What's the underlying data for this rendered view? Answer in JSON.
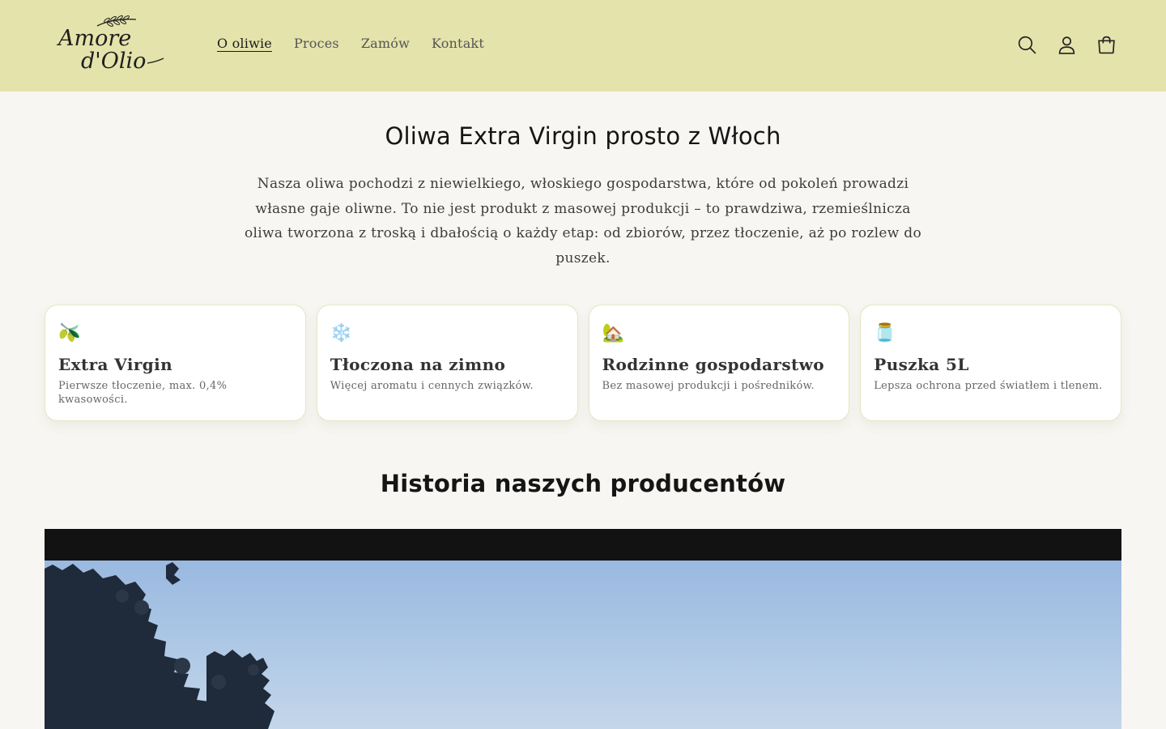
{
  "brand": {
    "logo_text": "Amore d'Olio"
  },
  "nav": {
    "items": [
      {
        "label": "O oliwie",
        "active": true
      },
      {
        "label": "Proces",
        "active": false
      },
      {
        "label": "Zamów",
        "active": false
      },
      {
        "label": "Kontakt",
        "active": false
      }
    ]
  },
  "header_icons": [
    "search-icon",
    "account-icon",
    "cart-icon"
  ],
  "hero": {
    "title": "Oliwa Extra Virgin prosto z Włoch",
    "description": "Nasza oliwa pochodzi z niewielkiego, włoskiego gospodarstwa, które od pokoleń prowadzi własne gaje oliwne. To nie jest produkt z masowej produkcji – to prawdziwa, rzemieślnicza oliwa tworzona z troską i dbałością o każdy etap: od zbiorów, przez tłoczenie, aż po rozlew do puszek."
  },
  "features": [
    {
      "icon": "🫒",
      "icon_name": "olive-icon",
      "title": "Extra Virgin",
      "desc": "Pierwsze tłoczenie, max. 0,4% kwasowości."
    },
    {
      "icon": "❄️",
      "icon_name": "snowflake-icon",
      "title": "Tłoczona na zimno",
      "desc": "Więcej aromatu i cennych związków."
    },
    {
      "icon": "🏡",
      "icon_name": "house-icon",
      "title": "Rodzinne gospodarstwo",
      "desc": "Bez masowej produkcji i pośredników."
    },
    {
      "icon": "🫙",
      "icon_name": "jar-icon",
      "title": "Puszka 5L",
      "desc": "Lepsza ochrona przed światłem i tlenem."
    }
  ],
  "producers": {
    "title": "Historia naszych producentów"
  },
  "colors": {
    "header_bg": "#e4e3ab",
    "page_bg": "#f8f6f2",
    "card_border": "#e4e6c2"
  }
}
